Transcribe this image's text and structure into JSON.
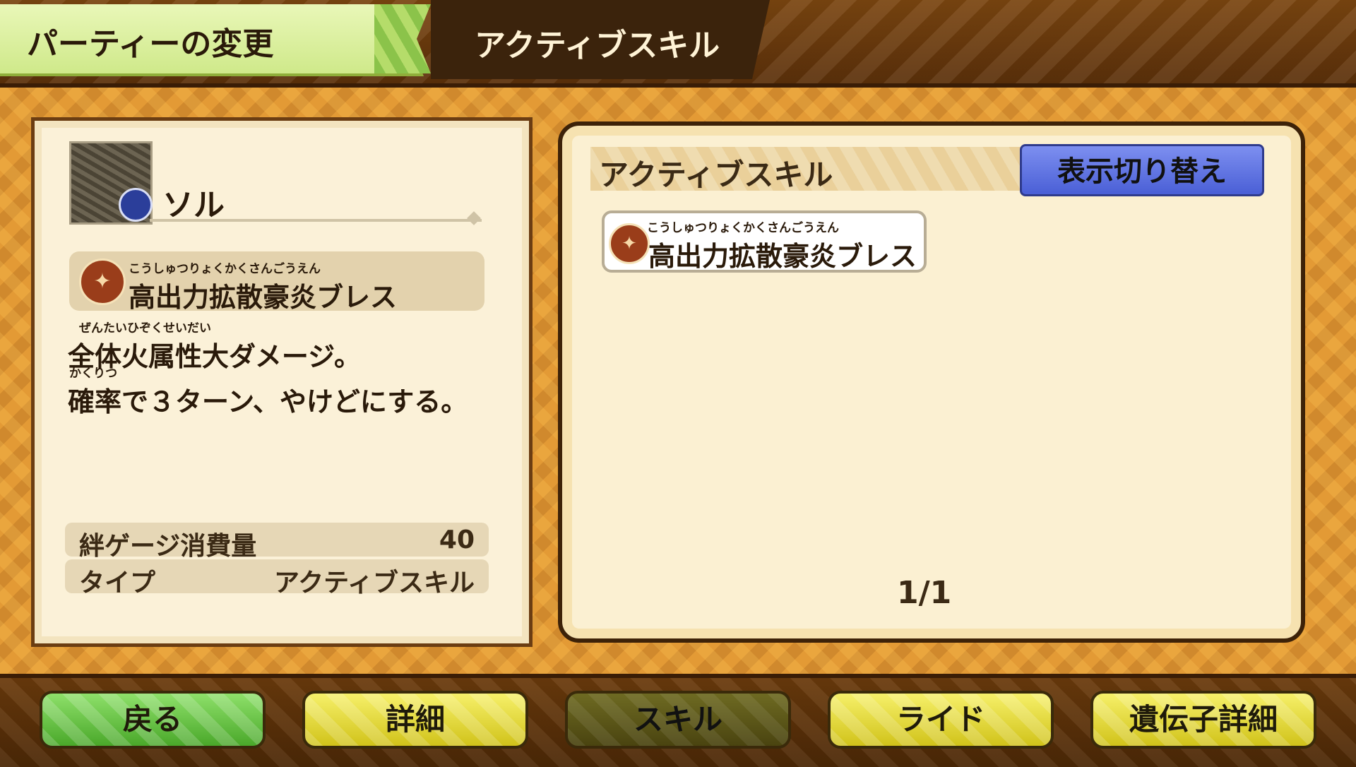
{
  "header": {
    "party_tab": "パーティーの変更",
    "current_tab": "アクティブスキル"
  },
  "monster": {
    "name": "ソル"
  },
  "skill_detail": {
    "ruby": "こうしゅつりょくかくさんごうえん",
    "name": "高出力拡散豪炎ブレス",
    "desc_ruby1": "ぜんたいひぞくせいだい",
    "desc_line1": "全体火属性大ダメージ。",
    "desc_ruby2": "かくりつ",
    "desc_line2": "確率で３ターン、やけどにする。",
    "stats": [
      {
        "label": "絆ゲージ消費量",
        "value": "40"
      },
      {
        "label": "タイプ",
        "value": "アクティブスキル"
      }
    ]
  },
  "skill_panel": {
    "title": "アクティブスキル",
    "toggle_label": "表示切り替え",
    "items": [
      {
        "ruby": "こうしゅつりょくかくさんごうえん",
        "name": "高出力拡散豪炎ブレス"
      }
    ],
    "page": "1/1"
  },
  "nav": {
    "back": "戻る",
    "details": "詳細",
    "skill": "スキル",
    "ride": "ライド",
    "gene_details": "遺伝子詳細"
  },
  "colors": {
    "parchment": "#fbf1d8",
    "accent_green": "#cfe98a",
    "toggle_blue": "#4a5fd6",
    "nav_yellow": "#d1c31a"
  }
}
